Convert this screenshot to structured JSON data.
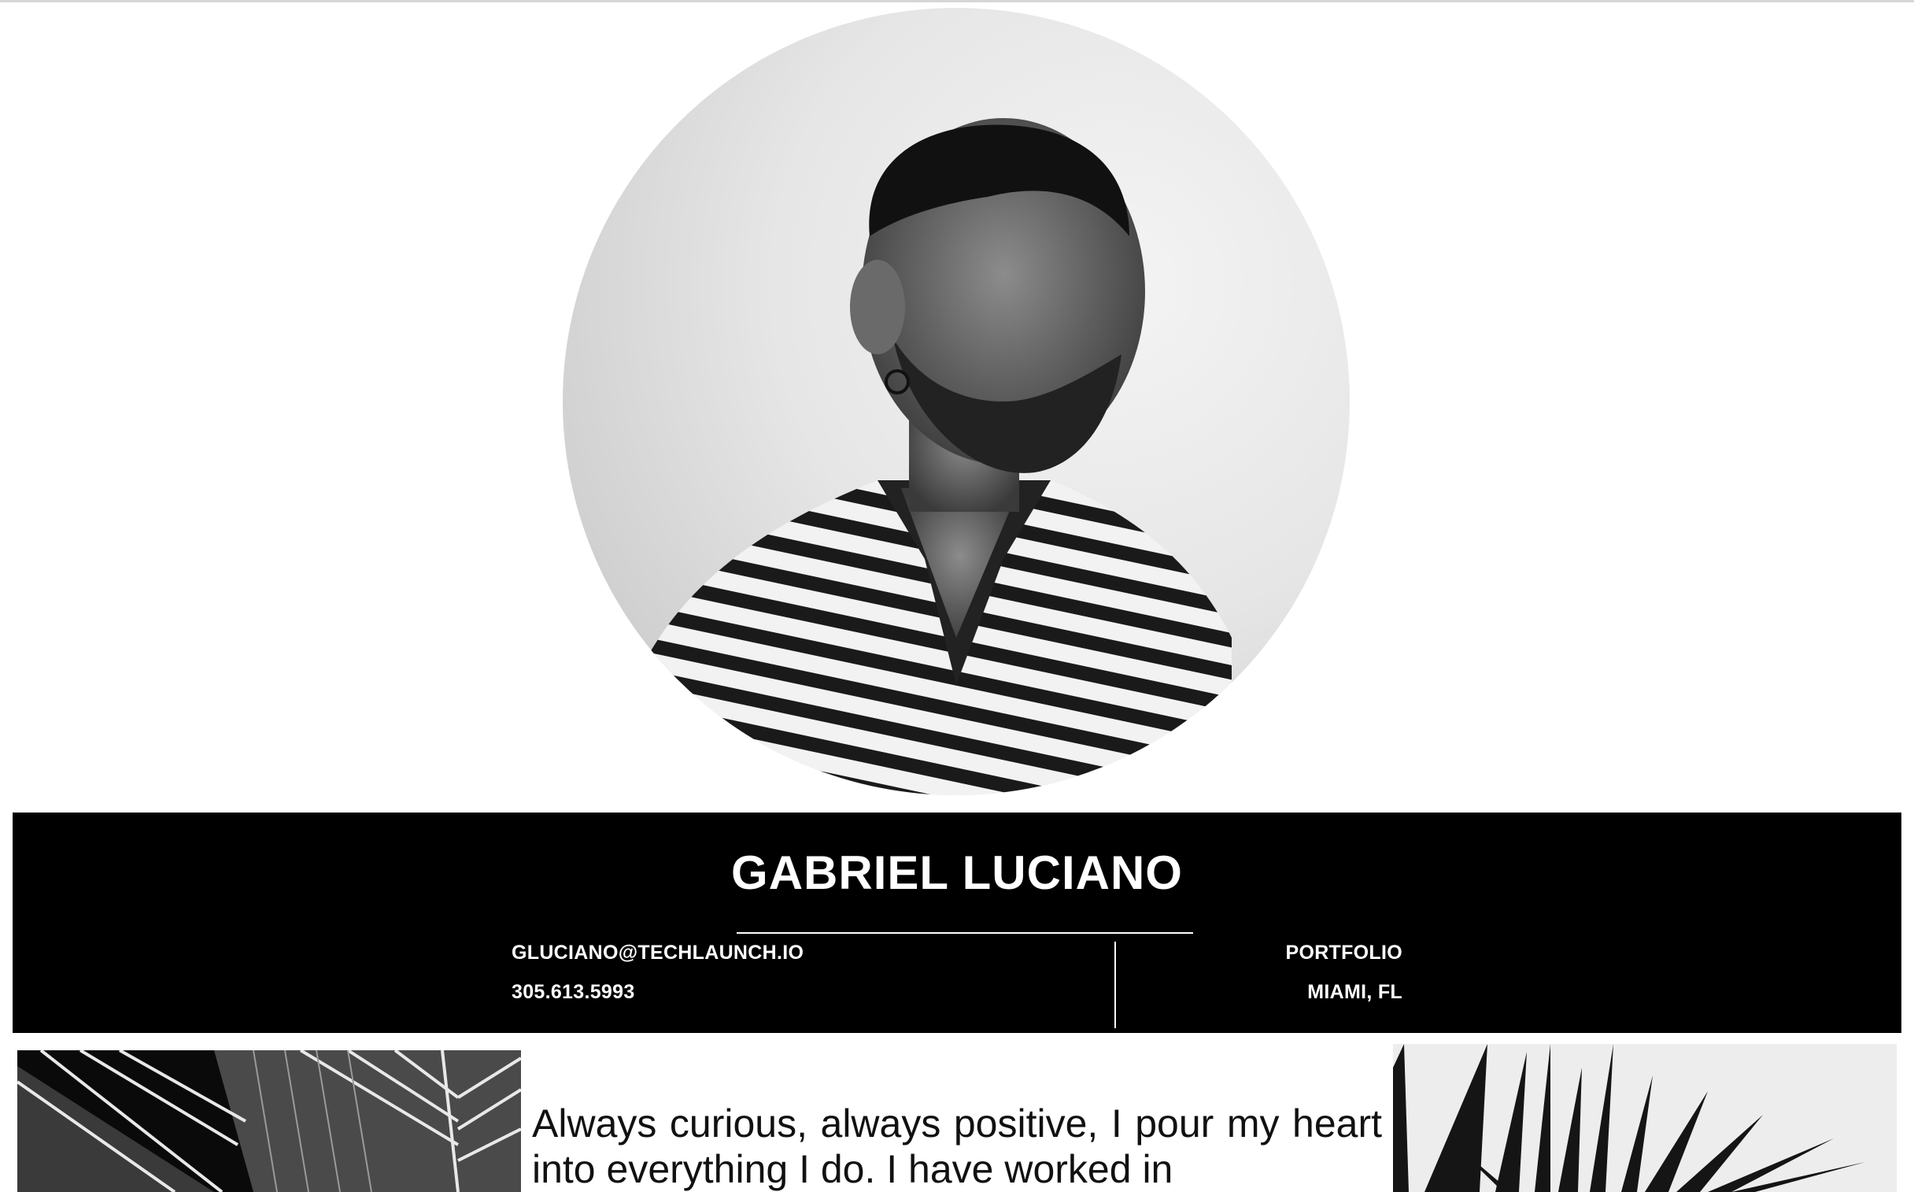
{
  "profile": {
    "name": "GABRIEL LUCIANO",
    "email": "GLUCIANO@TECHLAUNCH.IO",
    "phone": "305.613.5993",
    "portfolio_label": "PORTFOLIO",
    "location": "MIAMI, FL"
  },
  "bio": {
    "text": "Always curious, always positive, I pour my heart into everything I do. I have worked in"
  },
  "images": {
    "portrait": "portrait-photo",
    "left": "palm-leaf-photo",
    "right": "palm-frond-photo"
  },
  "colors": {
    "banner": "#000000",
    "banner_text": "#ffffff",
    "body_text": "#111111",
    "background": "#ffffff"
  }
}
